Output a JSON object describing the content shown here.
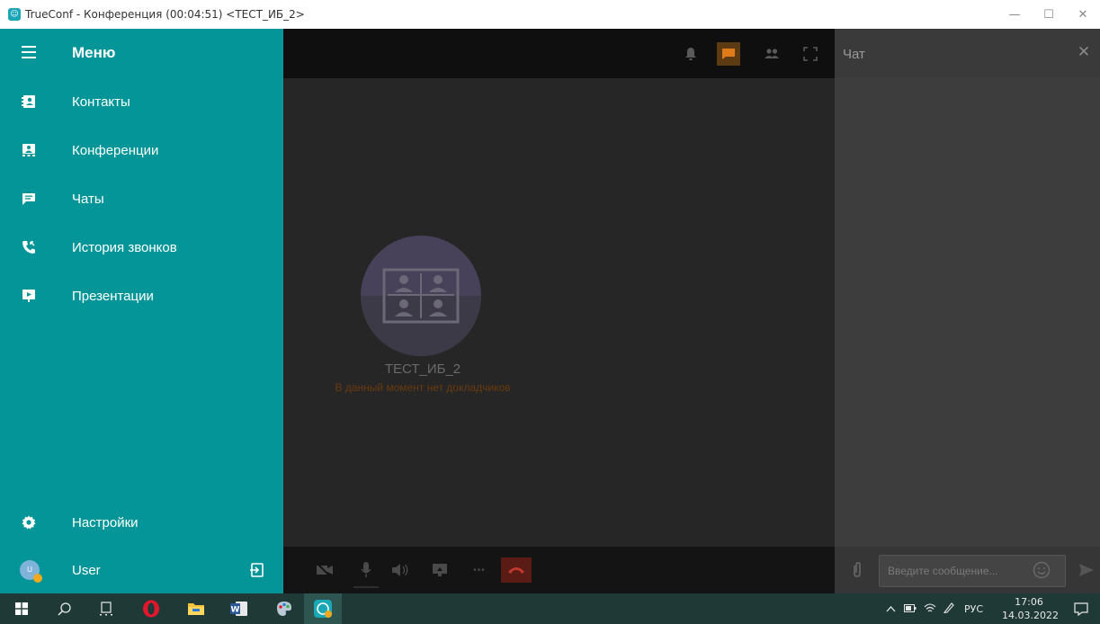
{
  "window": {
    "app_icon": "truconf-logo-icon",
    "title": "TrueConf - Конференция (00:04:51) <ТЕСТ_ИБ_2>",
    "minimize": "—",
    "maximize": "☐",
    "close": "✕"
  },
  "menu": {
    "title": "Меню",
    "items": [
      {
        "label": "Контакты",
        "icon": "contacts-icon"
      },
      {
        "label": "Конференции",
        "icon": "conferences-icon"
      },
      {
        "label": "Чаты",
        "icon": "chats-icon"
      },
      {
        "label": "История звонков",
        "icon": "call-history-icon"
      },
      {
        "label": "Презентации",
        "icon": "presentations-icon"
      }
    ],
    "settings": {
      "label": "Настройки",
      "icon": "gear-icon"
    },
    "user": {
      "label": "User",
      "avatar_initial": "U",
      "logout_icon": "logout-icon"
    }
  },
  "video": {
    "participant_name": "ТЕСТ_ИБ_2",
    "no_speaker_text": "В данный момент нет докладчиков",
    "more_label": "•••"
  },
  "chat": {
    "title": "Чат",
    "close": "✕",
    "placeholder": "Введите сообщение..."
  },
  "taskbar": {
    "tray_language": "РУС",
    "time": "17:06",
    "date": "14.03.2022"
  },
  "colors": {
    "sidebar": "#049599",
    "accent_chat": "#e07b1a",
    "hangup": "#c0392b"
  }
}
